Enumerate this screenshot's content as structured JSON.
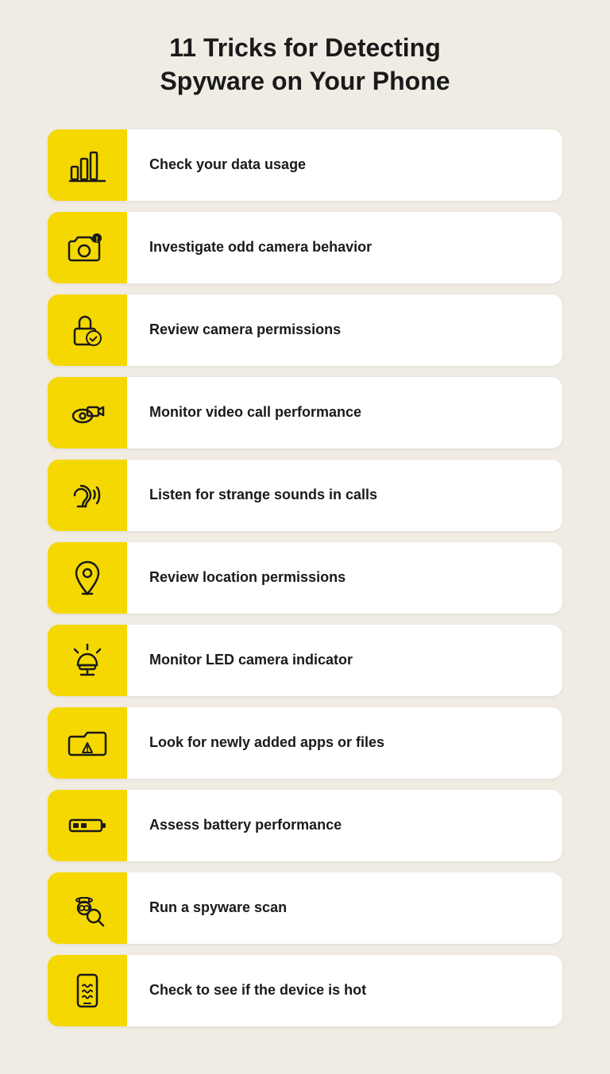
{
  "title": "11 Tricks for Detecting\nSpyware on Your Phone",
  "accent_color": "#f5d800",
  "items": [
    {
      "id": "data-usage",
      "label": "Check your data usage",
      "icon": "bar-chart"
    },
    {
      "id": "camera-behavior",
      "label": "Investigate odd camera behavior",
      "icon": "camera-alert"
    },
    {
      "id": "camera-permissions",
      "label": "Review camera permissions",
      "icon": "lock-check"
    },
    {
      "id": "video-call",
      "label": "Monitor video call performance",
      "icon": "video-eye"
    },
    {
      "id": "strange-sounds",
      "label": "Listen for strange sounds in calls",
      "icon": "ear-sound"
    },
    {
      "id": "location-permissions",
      "label": "Review location permissions",
      "icon": "location-pin"
    },
    {
      "id": "led-indicator",
      "label": "Monitor LED camera indicator",
      "icon": "alarm-light"
    },
    {
      "id": "new-apps",
      "label": "Look for newly added apps or files",
      "icon": "folder-warning"
    },
    {
      "id": "battery",
      "label": "Assess battery performance",
      "icon": "battery-low"
    },
    {
      "id": "spyware-scan",
      "label": "Run a spyware scan",
      "icon": "detective-scan"
    },
    {
      "id": "device-hot",
      "label": "Check to see if the device is hot",
      "icon": "phone-heat"
    }
  ]
}
